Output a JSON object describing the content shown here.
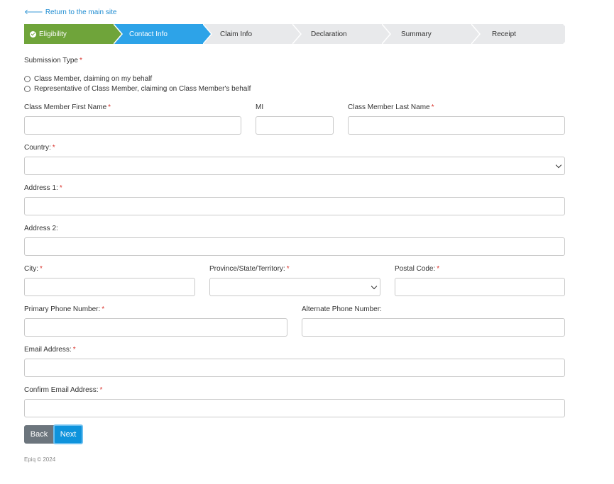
{
  "header": {
    "return_link": "Return to the main site"
  },
  "steps": [
    {
      "label": "Eligibility",
      "state": "done"
    },
    {
      "label": "Contact Info",
      "state": "active"
    },
    {
      "label": "Claim Info",
      "state": "pending"
    },
    {
      "label": "Declaration",
      "state": "pending"
    },
    {
      "label": "Summary",
      "state": "pending"
    },
    {
      "label": "Receipt",
      "state": "pending"
    }
  ],
  "colors": {
    "done": "#6fa43a",
    "active": "#2da3e8",
    "pending": "#e8e9eb",
    "required": "#d9322b"
  },
  "form": {
    "submission_type": {
      "label": "Submission Type",
      "options": [
        "Class Member, claiming on my behalf",
        "Representative of Class Member, claiming on Class Member's behalf"
      ]
    },
    "first_name": {
      "label": "Class Member First Name",
      "value": ""
    },
    "mi": {
      "label": "MI",
      "value": ""
    },
    "last_name": {
      "label": "Class Member Last Name",
      "value": ""
    },
    "country": {
      "label": "Country:",
      "value": ""
    },
    "address1": {
      "label": "Address 1:",
      "value": ""
    },
    "address2": {
      "label": "Address 2:",
      "value": ""
    },
    "city": {
      "label": "City:",
      "value": ""
    },
    "province": {
      "label": "Province/State/Territory:",
      "value": ""
    },
    "postal": {
      "label": "Postal Code:",
      "value": ""
    },
    "primary_phone": {
      "label": "Primary Phone Number:",
      "value": ""
    },
    "alt_phone": {
      "label": "Alternate Phone Number:",
      "value": ""
    },
    "email": {
      "label": "Email Address:",
      "value": ""
    },
    "confirm_email": {
      "label": "Confirm Email Address:",
      "value": ""
    },
    "required_mark": "*"
  },
  "buttons": {
    "back": "Back",
    "next": "Next"
  },
  "footer": {
    "copyright": "Epiq © 2024"
  }
}
